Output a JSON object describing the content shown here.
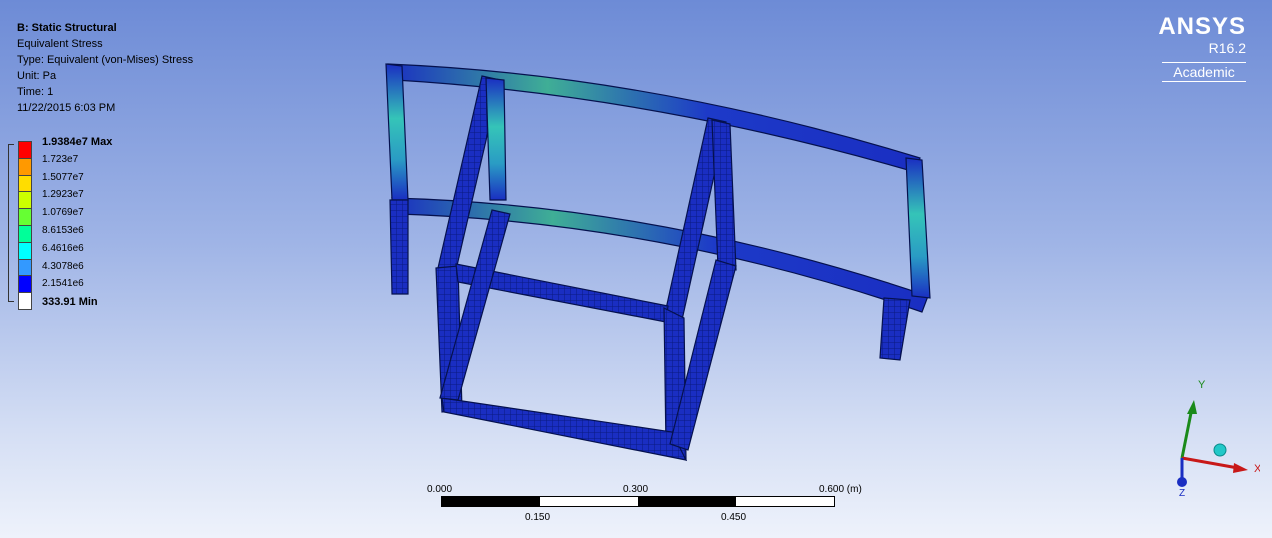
{
  "info": {
    "title": "B: Static Structural",
    "result": "Equivalent Stress",
    "type": "Type: Equivalent (von-Mises) Stress",
    "unit": "Unit: Pa",
    "time": "Time: 1",
    "date": "11/22/2015 6:03 PM"
  },
  "legend": {
    "labels": [
      "1.9384e7 Max",
      "1.723e7",
      "1.5077e7",
      "1.2923e7",
      "1.0769e7",
      "8.6153e6",
      "6.4616e6",
      "4.3078e6",
      "2.1541e6",
      "333.91 Min"
    ],
    "colors": [
      "#ff0000",
      "#ff9900",
      "#ffdd00",
      "#ccff00",
      "#66ff33",
      "#00ff99",
      "#00ffff",
      "#3399ff",
      "#0000ff"
    ]
  },
  "brand": {
    "name": "ANSYS",
    "version": "R16.2",
    "edition": "Academic"
  },
  "scale": {
    "top_labels": [
      "0.000",
      "0.300",
      "0.600 (m)"
    ],
    "bottom_labels": [
      "0.150",
      "0.450"
    ]
  },
  "triad": {
    "x": "X",
    "y": "Y",
    "z": "Z"
  },
  "colors": {
    "mesh_main": "#1a2ec2",
    "mesh_dark": "#0a1680",
    "mesh_line": "#05114e",
    "hot_green": "#4fa08a",
    "hot_cyan": "#33c7c0"
  }
}
